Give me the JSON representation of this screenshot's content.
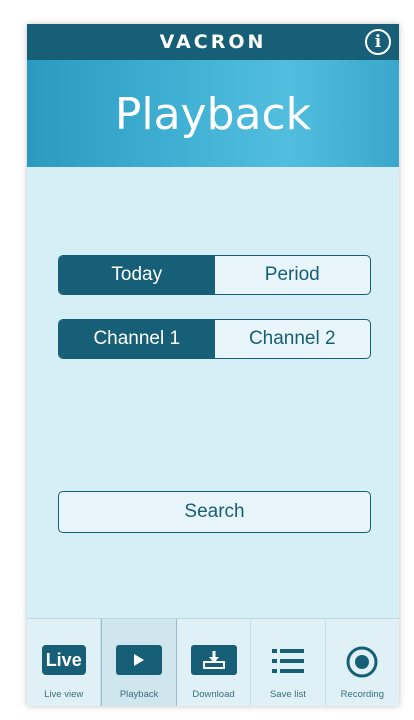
{
  "header": {
    "brand": "VACRON",
    "info_icon": "info-icon"
  },
  "banner": {
    "title": "Playback"
  },
  "date_toggle": {
    "options": [
      "Today",
      "Period"
    ],
    "selected": "Today"
  },
  "channel_toggle": {
    "options": [
      "Channel 1",
      "Channel 2"
    ],
    "selected": "Channel 1"
  },
  "search": {
    "label": "Search"
  },
  "tabs": [
    {
      "label": "Live view",
      "icon_text": "Live",
      "icon": "live-icon"
    },
    {
      "label": "Playback",
      "icon": "play-icon",
      "active": true
    },
    {
      "label": "Download",
      "icon": "download-icon"
    },
    {
      "label": "Save list",
      "icon": "list-icon"
    },
    {
      "label": "Recording",
      "icon": "record-icon"
    }
  ],
  "colors": {
    "primary": "#165f77",
    "banner": "#3fb0d3",
    "background": "#d6eef5"
  }
}
